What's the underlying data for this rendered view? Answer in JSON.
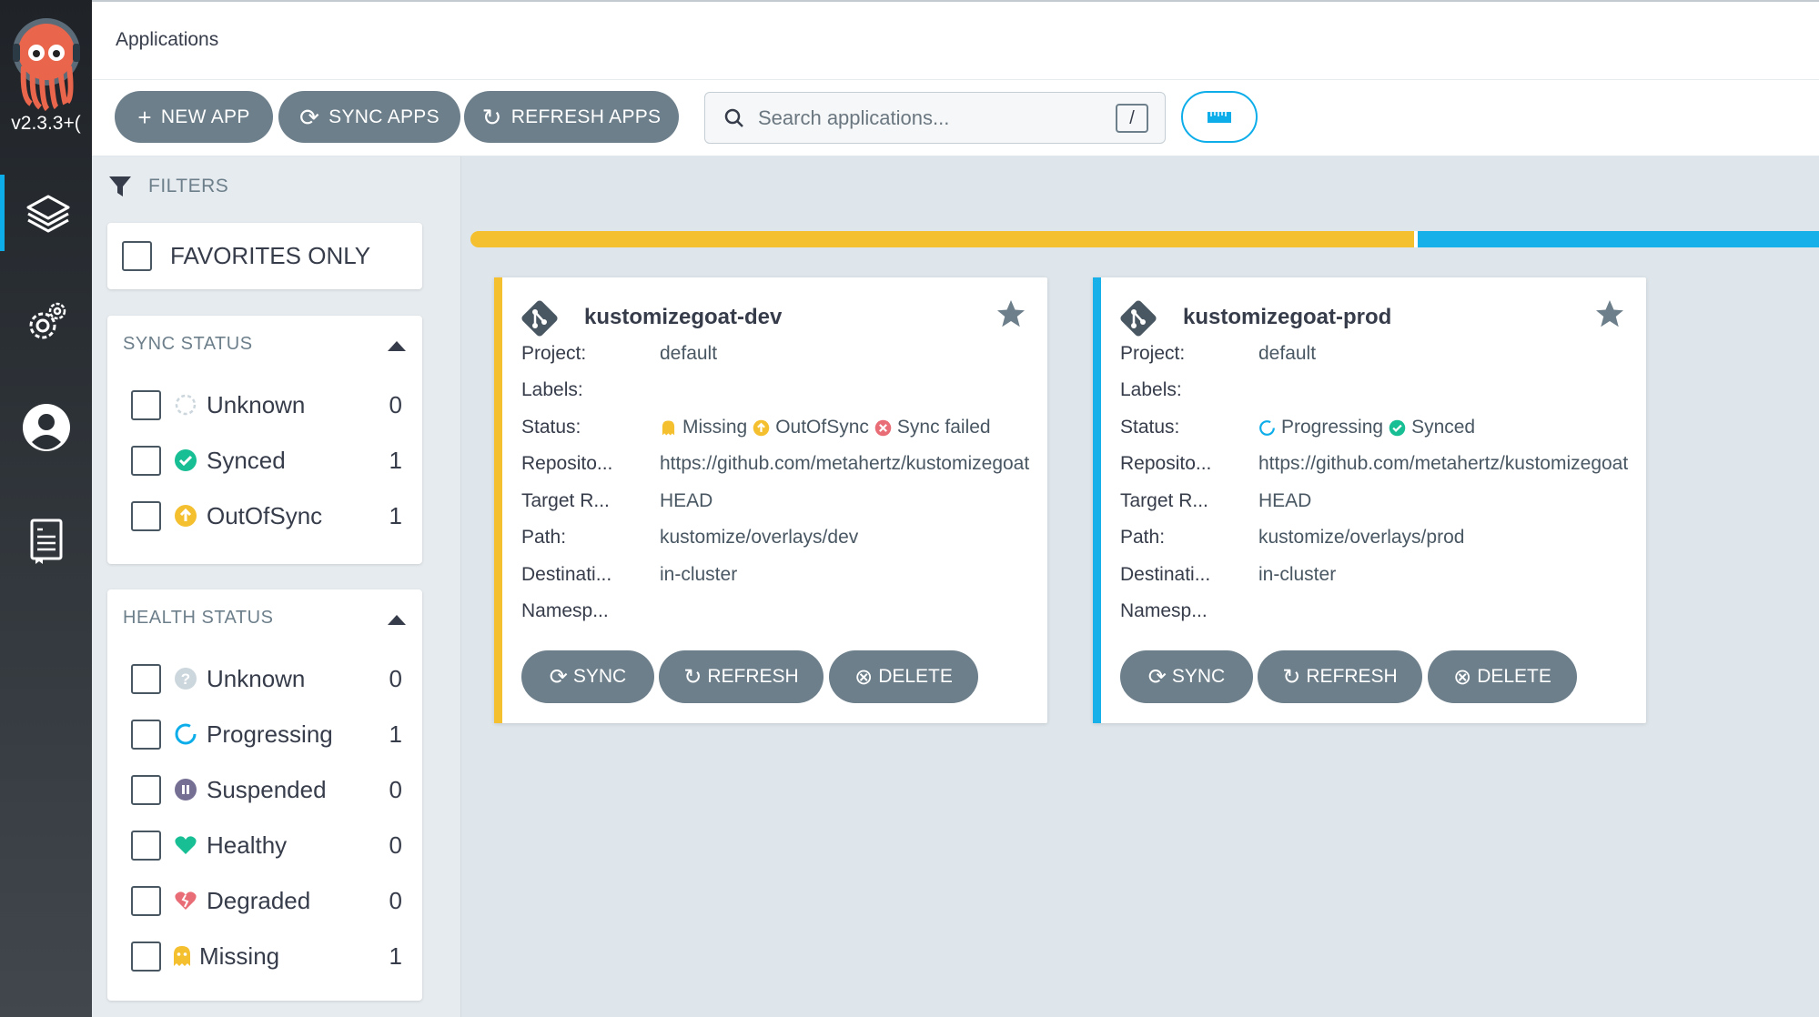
{
  "nav": {
    "version": "v2.3.3+(",
    "items": [
      "applications",
      "settings",
      "user-info",
      "docs"
    ]
  },
  "topbar": {
    "title": "Applications"
  },
  "toolbar": {
    "new_app": "NEW APP",
    "sync_apps": "SYNC APPS",
    "refresh_apps": "REFRESH APPS",
    "search_placeholder": "Search applications...",
    "search_shortcut": "/"
  },
  "filters": {
    "title": "FILTERS",
    "favorites_label": "FAVORITES ONLY",
    "sync_status": {
      "title": "SYNC STATUS",
      "items": [
        {
          "label": "Unknown",
          "count": "0"
        },
        {
          "label": "Synced",
          "count": "1"
        },
        {
          "label": "OutOfSync",
          "count": "1"
        }
      ]
    },
    "health_status": {
      "title": "HEALTH STATUS",
      "items": [
        {
          "label": "Unknown",
          "count": "0"
        },
        {
          "label": "Progressing",
          "count": "1"
        },
        {
          "label": "Suspended",
          "count": "0"
        },
        {
          "label": "Healthy",
          "count": "0"
        },
        {
          "label": "Degraded",
          "count": "0"
        },
        {
          "label": "Missing",
          "count": "1"
        }
      ]
    }
  },
  "summary_bar": {
    "missing_fraction": 0.5,
    "progressing_fraction": 0.5,
    "colors": {
      "missing": "#f4c030",
      "progressing": "#18b0e9"
    }
  },
  "field_labels": {
    "project": "Project:",
    "labels": "Labels:",
    "status": "Status:",
    "repo": "Reposito...",
    "target": "Target R...",
    "path": "Path:",
    "destination": "Destinati...",
    "namespace": "Namesp..."
  },
  "buttons": {
    "sync": "SYNC",
    "refresh": "REFRESH",
    "delete": "DELETE"
  },
  "apps": [
    {
      "name": "kustomizegoat-dev",
      "stripe_color": "#f4c030",
      "project": "default",
      "labels": "",
      "status": [
        "Missing",
        "OutOfSync",
        "Sync failed"
      ],
      "repo": "https://github.com/metahertz/kustomizegoat",
      "target": "HEAD",
      "path": "kustomize/overlays/dev",
      "destination": "in-cluster",
      "namespace": ""
    },
    {
      "name": "kustomizegoat-prod",
      "stripe_color": "#18b0e9",
      "project": "default",
      "labels": "",
      "status": [
        "Progressing",
        "Synced"
      ],
      "repo": "https://github.com/metahertz/kustomizegoat",
      "target": "HEAD",
      "path": "kustomize/overlays/prod",
      "destination": "in-cluster",
      "namespace": ""
    }
  ]
}
